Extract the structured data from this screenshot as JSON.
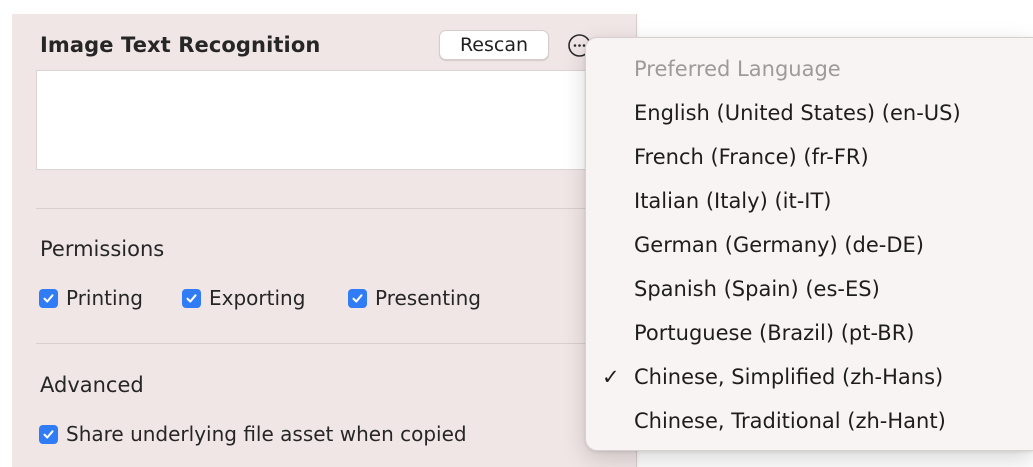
{
  "panel": {
    "title": "Image Text Recognition",
    "rescan_label": "Rescan",
    "more_icon": "ellipsis-circle-icon",
    "recognized_text": ""
  },
  "permissions": {
    "heading": "Permissions",
    "items": [
      {
        "label": "Printing",
        "checked": true
      },
      {
        "label": "Exporting",
        "checked": true
      },
      {
        "label": "Presenting",
        "checked": true
      }
    ]
  },
  "advanced": {
    "heading": "Advanced",
    "items": [
      {
        "label": "Share underlying file asset when copied",
        "checked": true
      }
    ]
  },
  "language_menu": {
    "header": "Preferred Language",
    "selected_index": 7,
    "items": [
      {
        "label": "English (United States) (en-US)"
      },
      {
        "label": "French (France) (fr-FR)"
      },
      {
        "label": "Italian (Italy) (it-IT)"
      },
      {
        "label": "German (Germany) (de-DE)"
      },
      {
        "label": "Spanish (Spain) (es-ES)"
      },
      {
        "label": "Portuguese (Brazil) (pt-BR)"
      },
      {
        "label": "Chinese, Simplified (zh-Hans)"
      },
      {
        "label": "Chinese, Traditional (zh-Hant)"
      }
    ],
    "check_glyph": "✓"
  },
  "colors": {
    "panel_bg": "#f1e6e6",
    "checkbox_accent": "#2f7cf6",
    "menu_bg": "#f9f4f4",
    "menu_header_text": "#9d9a9a"
  }
}
